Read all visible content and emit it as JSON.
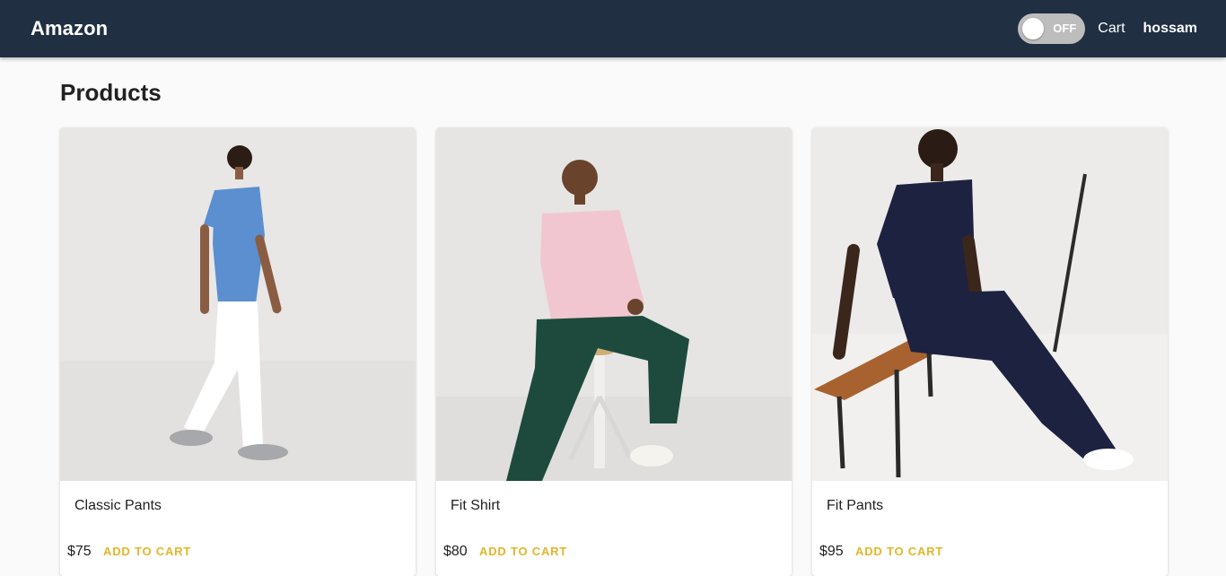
{
  "header": {
    "brand": "Amazon",
    "toggle_state": "OFF",
    "cart_label": "Cart",
    "username": "hossam",
    "background": "#212f43"
  },
  "main": {
    "title": "Products",
    "products": [
      {
        "name": "Classic Pants",
        "price": "$75",
        "action": "ADD TO CART"
      },
      {
        "name": "Fit Shirt",
        "price": "$80",
        "action": "ADD TO CART"
      },
      {
        "name": "Fit Pants",
        "price": "$95",
        "action": "ADD TO CART"
      }
    ],
    "accent": "#e4b52a"
  }
}
